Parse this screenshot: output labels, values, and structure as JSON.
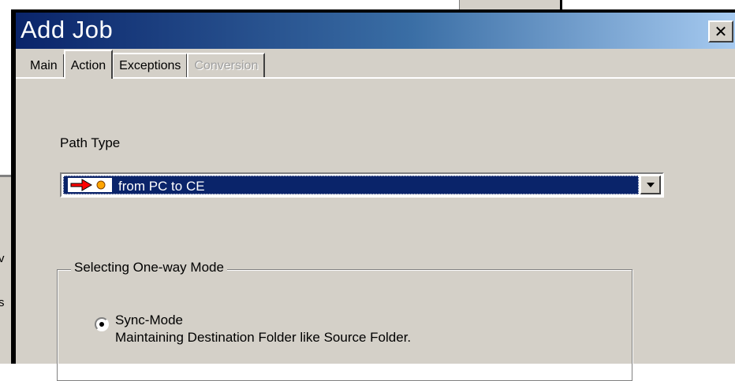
{
  "background": {
    "edge_chars": [
      "v",
      "s"
    ]
  },
  "dialog": {
    "title": "Add Job",
    "close_symbol": "✕",
    "tabs": [
      {
        "label": "Main",
        "state": "normal"
      },
      {
        "label": "Action",
        "state": "active"
      },
      {
        "label": "Exceptions",
        "state": "normal"
      },
      {
        "label": "Conversion",
        "state": "disabled"
      }
    ],
    "path_type": {
      "label": "Path Type",
      "selected": "from PC to CE",
      "icon": "arrow-right-to-circle-icon"
    },
    "mode_group": {
      "legend": "Selecting One-way Mode",
      "option": {
        "label": "Sync-Mode",
        "description": "Maintaining Destination Folder like Source Folder.",
        "checked": true
      }
    }
  },
  "colors": {
    "title_start": "#0a246a",
    "title_end": "#a6caf0",
    "face": "#d4d0c8",
    "selection": "#0a246a",
    "arrow_red": "#ff0000",
    "circle_orange": "#ffa500"
  }
}
